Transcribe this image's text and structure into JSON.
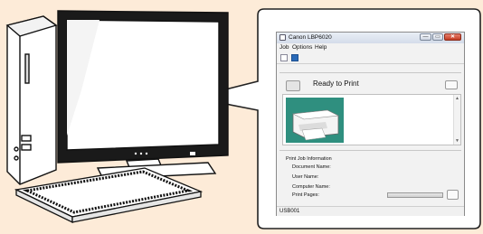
{
  "window": {
    "title": "Canon LBP6020",
    "app_icon": "printer-icon",
    "buttons": {
      "minimize": "—",
      "maximize": "▭",
      "close": "✕"
    }
  },
  "menu": {
    "items": [
      "Job",
      "Options",
      "Help"
    ]
  },
  "toolbar": {
    "icons": [
      "document-icon",
      "refresh-icon"
    ]
  },
  "status": {
    "text": "Ready to Print",
    "icon": "printer-status-icon"
  },
  "job_info": {
    "heading": "Print Job Information",
    "labels": {
      "document_name": "Document Name:",
      "user_name": "User Name:",
      "computer_name": "Computer Name:",
      "print_pages": "Print Pages:"
    },
    "progress": 0
  },
  "statusbar": {
    "port": "USB001"
  },
  "colors": {
    "callout_bg": "#fdebd8",
    "printer_area": "#2f8f7f",
    "close_button": "#c23b22"
  }
}
